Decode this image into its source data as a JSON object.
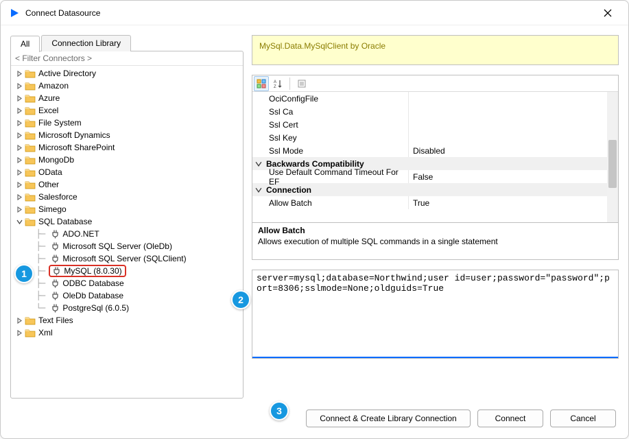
{
  "window": {
    "title": "Connect Datasource"
  },
  "tabs": {
    "all": "All",
    "library": "Connection Library"
  },
  "filter_placeholder": "< Filter Connectors >",
  "tree": {
    "folders_top": [
      "Active Directory",
      "Amazon",
      "Azure",
      "Excel",
      "File System",
      "Microsoft Dynamics",
      "Microsoft SharePoint",
      "MongoDb",
      "OData",
      "Other",
      "Salesforce",
      "Simego"
    ],
    "sql_folder": "SQL Database",
    "sql_children": [
      "ADO.NET",
      "Microsoft SQL Server (OleDb)",
      "Microsoft SQL Server (SQLClient)",
      "MySQL (8.0.30)",
      "ODBC Database",
      "OleDb Database",
      "PostgreSql (6.0.5)"
    ],
    "folders_bottom": [
      "Text Files",
      "Xml"
    ]
  },
  "provider_banner": "MySql.Data.MySqlClient by Oracle",
  "props": {
    "rows_loose": [
      {
        "name": "OciConfigFile",
        "val": ""
      },
      {
        "name": "Ssl Ca",
        "val": ""
      },
      {
        "name": "Ssl Cert",
        "val": ""
      },
      {
        "name": "Ssl Key",
        "val": ""
      },
      {
        "name": "Ssl Mode",
        "val": "Disabled"
      }
    ],
    "group_backcompat": "Backwards Compatibility",
    "row_bc": {
      "name": "Use Default Command Timeout For EF",
      "val": "False"
    },
    "group_connection": "Connection",
    "row_conn": {
      "name": "Allow Batch",
      "val": "True"
    },
    "desc_title": "Allow Batch",
    "desc_text": "Allows execution of multiple SQL commands in a single statement"
  },
  "conn_string": "server=mysql;database=Northwind;user id=user;password=\"password\";port=8306;sslmode=None;oldguids=True",
  "buttons": {
    "create_lib": "Connect & Create Library Connection",
    "connect": "Connect",
    "cancel": "Cancel"
  },
  "callouts": {
    "one": "1",
    "two": "2",
    "three": "3"
  }
}
